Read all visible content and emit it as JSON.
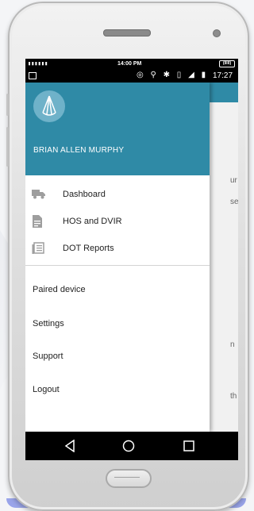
{
  "status_bar": {
    "signal": "▮▮▮▮▮▮",
    "time": "14:00 PM",
    "battery": "(IIIII)",
    "clock": "17:27"
  },
  "drawer": {
    "user_name": "BRIAN ALLEN MURPHY",
    "primary_items": [
      {
        "label": "Dashboard",
        "icon": "truck-icon"
      },
      {
        "label": "HOS and DVIR",
        "icon": "document-icon"
      },
      {
        "label": "DOT Reports",
        "icon": "report-icon"
      }
    ],
    "secondary_items": [
      {
        "label": "Paired device"
      },
      {
        "label": "Settings"
      },
      {
        "label": "Support"
      },
      {
        "label": "Logout"
      }
    ]
  },
  "background_fragments": [
    "ur",
    "se",
    "n",
    "th"
  ],
  "colors": {
    "header": "#2f8aa6",
    "drawer_bg": "#ffffff",
    "icon_gray": "#9e9e9e"
  }
}
